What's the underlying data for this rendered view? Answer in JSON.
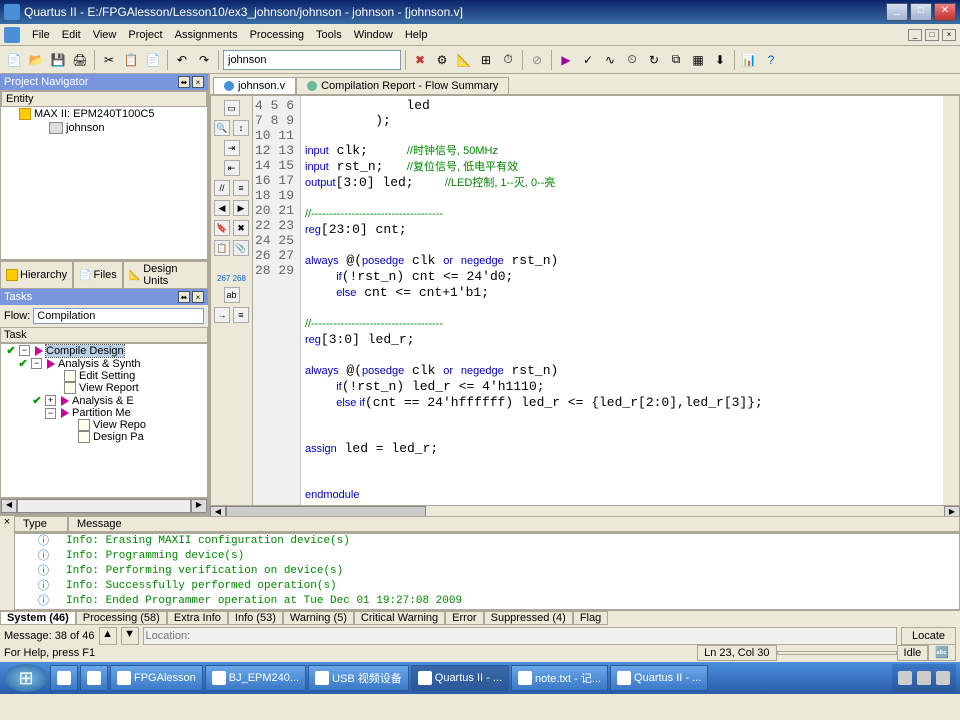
{
  "window": {
    "title": "Quartus II - E:/FPGAlesson/Lesson10/ex3_johnson/johnson - johnson - [johnson.v]"
  },
  "menu": {
    "file": "File",
    "edit": "Edit",
    "view": "View",
    "project": "Project",
    "assignments": "Assignments",
    "processing": "Processing",
    "tools": "Tools",
    "window": "Window",
    "help": "Help"
  },
  "toolbar": {
    "combo": "johnson"
  },
  "project_navigator": {
    "title": "Project Navigator",
    "entity_header": "Entity",
    "device": "MAX II: EPM240T100C5",
    "top": "johnson",
    "tabs": {
      "hierarchy": "Hierarchy",
      "files": "Files",
      "design_units": "Design Units"
    }
  },
  "tasks": {
    "title": "Tasks",
    "flow_label": "Flow:",
    "flow_value": "Compilation",
    "header": "Task",
    "items": [
      "Compile Design",
      "Analysis & Synth",
      "Edit Setting",
      "View Report",
      "Analysis & E",
      "Partition Me",
      "View Repo",
      "Design Pa"
    ]
  },
  "editor": {
    "tab1": "johnson.v",
    "tab2": "Compilation Report - Flow Summary",
    "gutter": [
      "4",
      "5",
      "6",
      "7",
      "8",
      "9",
      "10",
      "11",
      "12",
      "13",
      "14",
      "15",
      "16",
      "17",
      "18",
      "19",
      "20",
      "21",
      "22",
      "23",
      "24",
      "25",
      "26",
      "27",
      "28",
      "29"
    ],
    "line_counts": "267\n268"
  },
  "code": {
    "l4": "             led",
    "l5": "         );",
    "l6": "",
    "l7a": "input",
    "l7b": " clk;     ",
    "l7c": "//时钟信号, 50MHz",
    "l8a": "input",
    "l8b": " rst_n;   ",
    "l8c": "//复位信号, 低电平有效",
    "l9a": "output",
    "l9b": "[3:0] led;    ",
    "l9c": "//LED控制, 1--灭, 0--亮",
    "l10": "",
    "l11": "//------------------------------------",
    "l12a": "reg",
    "l12b": "[23:0] cnt;",
    "l13": "",
    "l14a": "always",
    "l14b": " @(",
    "l14c": "posedge",
    "l14d": " clk ",
    "l14e": "or",
    "l14f": " ",
    "l14g": "negedge",
    "l14h": " rst_n)",
    "l15a": "    ",
    "l15b": "if",
    "l15c": "(!rst_n) cnt <= 24'd0;",
    "l16a": "    ",
    "l16b": "else",
    "l16c": " cnt <= cnt+1'b1;",
    "l17": "",
    "l18": "//------------------------------------",
    "l19a": "reg",
    "l19b": "[3:0] led_r;",
    "l20": "",
    "l21a": "always",
    "l21b": " @(",
    "l21c": "posedge",
    "l21d": " clk ",
    "l21e": "or",
    "l21f": " ",
    "l21g": "negedge",
    "l21h": " rst_n)",
    "l22a": "    ",
    "l22b": "if",
    "l22c": "(!rst_n) led_r <= 4'h1110;",
    "l23a": "    ",
    "l23b": "else if",
    "l23c": "(cnt == 24'hffffff) led_r <= {led_r[2:0],led_r[3]};",
    "l24": "",
    "l25": "",
    "l26a": "assign",
    "l26b": " led = led_r;",
    "l27": "",
    "l28": "",
    "l29a": "endmodule"
  },
  "messages": {
    "col_type": "Type",
    "col_msg": "Message",
    "rows": [
      "Info: Erasing MAXII configuration device(s)",
      "Info: Programming device(s)",
      "Info: Performing verification on device(s)",
      "Info: Successfully performed operation(s)",
      "Info: Ended Programmer operation at Tue Dec 01 19:27:08 2009"
    ],
    "tabs": {
      "system": "System (46)",
      "processing": "Processing (58)",
      "extra": "Extra Info",
      "info": "Info (53)",
      "warning": "Warning (5)",
      "critical": "Critical Warning",
      "error": "Error",
      "suppressed": "Suppressed (4)",
      "flag": "Flag"
    },
    "footer_label": "Message: 38 of 46",
    "location_placeholder": "Location:",
    "locate_btn": "Locate"
  },
  "status": {
    "help": "For Help, press F1",
    "pos": "Ln 23, Col 30",
    "idle": "Idle"
  },
  "taskbar": {
    "items": [
      "FPGAlesson",
      "BJ_EPM240...",
      "USB 视频设备",
      "Quartus II - ...",
      "note.txt - 记...",
      "Quartus II - ..."
    ]
  }
}
